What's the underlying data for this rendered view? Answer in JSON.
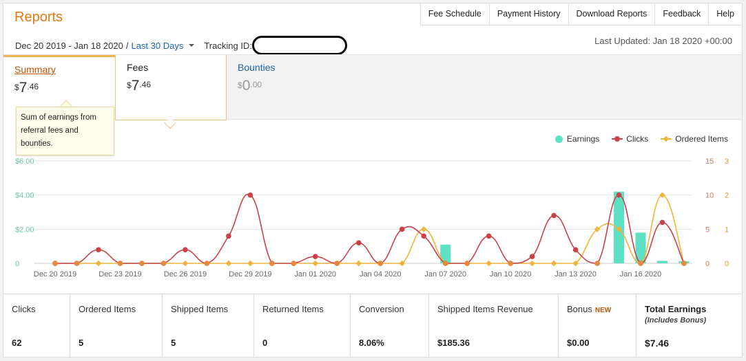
{
  "header": {
    "title": "Reports"
  },
  "topnav": [
    "Fee Schedule",
    "Payment History",
    "Download Reports",
    "Feedback",
    "Help"
  ],
  "date_range": {
    "range": "Dec 20 2019 - Jan 18 2020",
    "separator": "/",
    "preset": "Last 30 Days"
  },
  "tracking": {
    "label": "Tracking ID:"
  },
  "last_updated": "Last Updated: Jan 18 2020 +00:00",
  "tabs": [
    {
      "label": "Summary",
      "currency": "$",
      "whole": "7",
      "cents": ".46"
    },
    {
      "label": "Fees",
      "currency": "$",
      "whole": "7",
      "cents": ".46"
    },
    {
      "label": "Bounties",
      "currency": "$",
      "whole": "0",
      "cents": ".00"
    }
  ],
  "tooltip": "Sum of earnings from referral fees and bounties.",
  "legend": {
    "earnings": "Earnings",
    "clicks": "Clicks",
    "items": "Ordered Items"
  },
  "colors": {
    "accent": "#e47911",
    "link": "#1c63a6",
    "earnings": "#5ee0c4",
    "clicks": "#c9424a",
    "items": "#f0b43a"
  },
  "chart_data": {
    "type": "bar",
    "x": [
      "Dec 20",
      "Dec 21",
      "Dec 22",
      "Dec 23",
      "Dec 24",
      "Dec 25",
      "Dec 26",
      "Dec 27",
      "Dec 28",
      "Dec 29",
      "Dec 30",
      "Dec 31",
      "Jan 01",
      "Jan 02",
      "Jan 03",
      "Jan 04",
      "Jan 05",
      "Jan 06",
      "Jan 07",
      "Jan 08",
      "Jan 09",
      "Jan 10",
      "Jan 11",
      "Jan 12",
      "Jan 13",
      "Jan 14",
      "Jan 15",
      "Jan 16",
      "Jan 17",
      "Jan 18"
    ],
    "xticks": [
      "Dec 20 2019",
      "Dec 23 2019",
      "Dec 26 2019",
      "Dec 29 2019",
      "Jan 01 2020",
      "Jan 04 2020",
      "Jan 07 2020",
      "Jan 10 2020",
      "Jan 13 2020",
      "Jan 16 2020"
    ],
    "series": [
      {
        "name": "Earnings",
        "type": "bar",
        "axis": "$",
        "values": [
          0,
          0,
          0,
          0,
          0,
          0,
          0,
          0,
          0,
          0,
          0,
          0,
          0,
          0,
          0,
          0,
          0,
          0,
          1.1,
          0,
          0,
          0,
          0,
          0,
          0,
          0,
          4.2,
          1.8,
          0.15,
          0.12
        ]
      },
      {
        "name": "Clicks",
        "type": "line",
        "axis": "clicks",
        "values": [
          0,
          0,
          2,
          0,
          0,
          0,
          2,
          0,
          4,
          10,
          0,
          0,
          1,
          0,
          3,
          0,
          5,
          4,
          0,
          0,
          4,
          0,
          1,
          7,
          2,
          0,
          10,
          0,
          6,
          0
        ]
      },
      {
        "name": "Ordered Items",
        "type": "line",
        "axis": "items",
        "values": [
          0,
          0,
          0,
          0,
          0,
          0,
          0,
          0,
          0,
          0,
          0,
          0,
          0,
          0,
          0,
          0,
          0,
          1,
          0,
          0,
          0,
          0,
          0,
          0,
          0,
          1,
          1,
          0,
          2,
          0
        ]
      }
    ],
    "y_left": {
      "ticks": [
        "$6.00",
        "$4.00",
        "$2.00",
        "0"
      ],
      "lim": [
        0,
        6
      ]
    },
    "y_clicks": {
      "ticks": [
        "15",
        "10",
        "5",
        "0"
      ],
      "lim": [
        0,
        15
      ]
    },
    "y_items": {
      "ticks": [
        "3",
        "2",
        "1",
        "0"
      ],
      "lim": [
        0,
        3
      ]
    },
    "grid": true,
    "legend": "top-right"
  },
  "stats": [
    {
      "label": "Clicks",
      "value": "62"
    },
    {
      "label": "Ordered Items",
      "value": "5"
    },
    {
      "label": "Shipped Items",
      "value": "5"
    },
    {
      "label": "Returned Items",
      "value": "0"
    },
    {
      "label": "Conversion",
      "value": "8.06%"
    },
    {
      "label": "Shipped Items Revenue",
      "value": "$185.36"
    },
    {
      "label": "Bonus",
      "badge": "NEW",
      "value": "$0.00"
    },
    {
      "label": "Total Earnings",
      "sub": "(Includes Bonus)",
      "value": "$7.46"
    }
  ]
}
